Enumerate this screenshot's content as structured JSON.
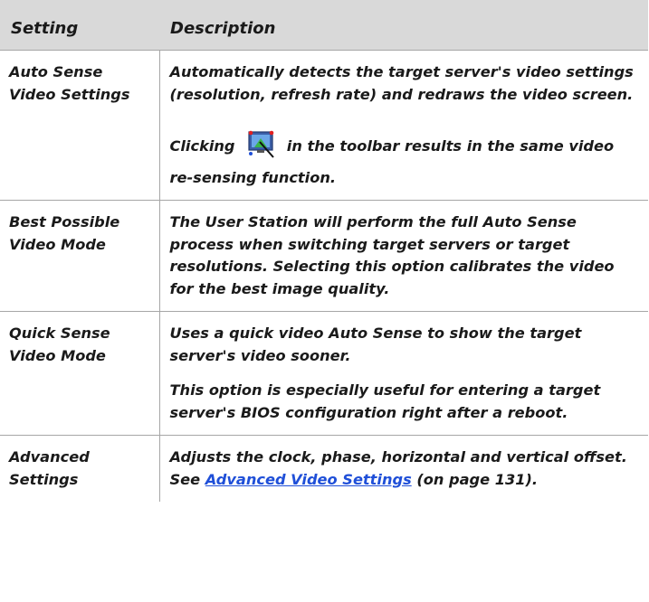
{
  "header": {
    "setting": "Setting",
    "description": "Description"
  },
  "rows": [
    {
      "setting": "Auto Sense Video Settings",
      "description": "Automatically detects the target server's video settings (resolution, refresh rate) and redraws the video screen.",
      "clicking_prefix": "Clicking",
      "clicking_suffix": "in the toolbar results in the same video re-sensing function.",
      "icon": "auto-sense-video-icon"
    },
    {
      "setting": "Best Possible Video Mode",
      "description": "The User Station will perform the full Auto Sense process when switching target servers or target resolutions. Selecting this option calibrates the video for the best image quality."
    },
    {
      "setting": "Quick Sense Video Mode",
      "description": "Uses a quick video Auto Sense to show the target server's video sooner.",
      "description2": "This option is especially useful for entering a target server's BIOS configuration right after a reboot."
    },
    {
      "setting": "Advanced Settings",
      "description_prefix": "Adjusts the clock, phase, horizontal and vertical offset. See",
      "link_text": "Advanced Video Settings",
      "description_suffix": "(on page 131)."
    }
  ],
  "colors": {
    "header_bg": "#d9d9d9",
    "link": "#1f4fd8",
    "border": "#a6a6a6"
  }
}
